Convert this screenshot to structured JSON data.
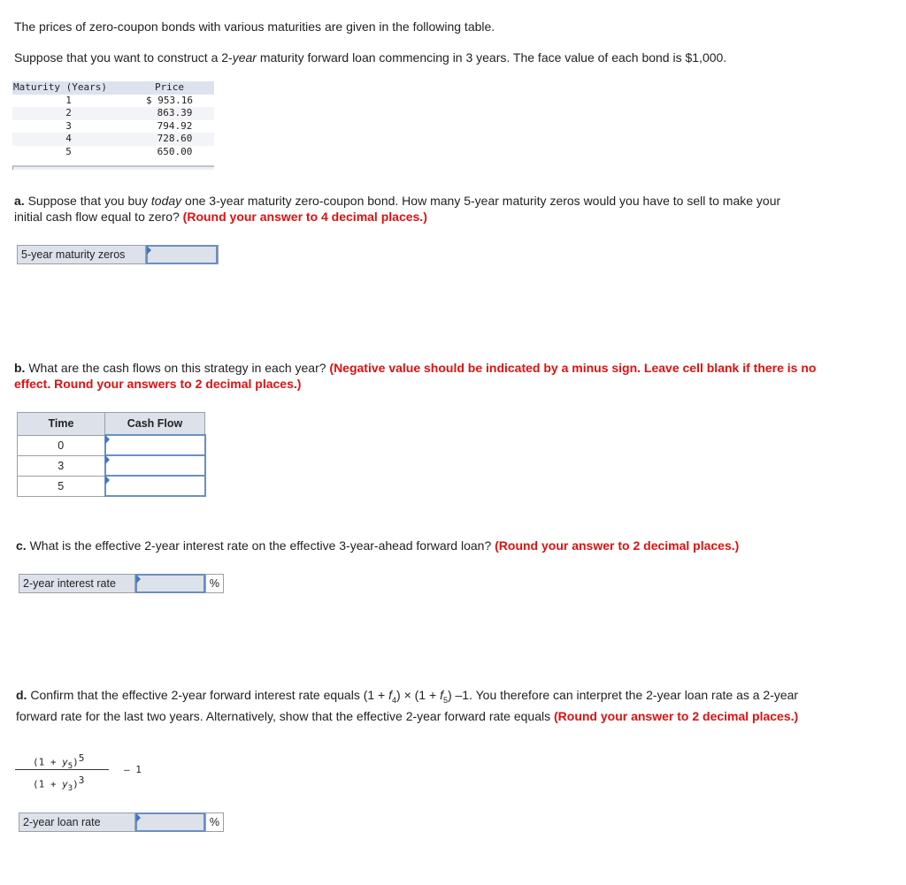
{
  "intro": {
    "line1": "The prices of zero-coupon bonds with various maturities are given in the following table.",
    "line2_pre": "Suppose that you want to construct a 2-",
    "line2_italic": "year",
    "line2_post": " maturity forward loan commencing in 3 years. The face value of each bond is $1,000."
  },
  "bond_table": {
    "headers": [
      "Maturity (Years)",
      "Price"
    ],
    "rows": [
      {
        "maturity": "1",
        "price": "$ 953.16"
      },
      {
        "maturity": "2",
        "price": "863.39"
      },
      {
        "maturity": "3",
        "price": "794.92"
      },
      {
        "maturity": "4",
        "price": "728.60"
      },
      {
        "maturity": "5",
        "price": "650.00"
      }
    ]
  },
  "part_a": {
    "letter": "a.",
    "text_pre": " Suppose that you buy ",
    "text_italic": "today",
    "text_post": " one 3-year maturity zero-coupon bond. How many 5-year maturity zeros would you have to sell to make your initial cash flow equal to zero? ",
    "instruction": "(Round your answer to 4 decimal places.)",
    "answer_label": "5-year maturity zeros",
    "answer_value": ""
  },
  "part_b": {
    "letter": "b.",
    "text": " What are the cash flows on this strategy in each year? ",
    "instruction": "(Negative value should be indicated by a minus sign. Leave cell blank if there is no effect. Round your answers to 2 decimal places.)",
    "table": {
      "headers": [
        "Time",
        "Cash Flow"
      ],
      "rows": [
        {
          "time": "0",
          "cash_flow": ""
        },
        {
          "time": "3",
          "cash_flow": ""
        },
        {
          "time": "5",
          "cash_flow": ""
        }
      ]
    }
  },
  "part_c": {
    "letter": "c.",
    "text": " What is the effective 2-year interest rate on the effective 3-year-ahead forward loan? ",
    "instruction": "(Round your answer to 2 decimal places.)",
    "answer_label": "2-year interest rate",
    "answer_value": "",
    "unit": "%"
  },
  "part_d": {
    "letter": "d.",
    "text_1": " Confirm that the effective 2-year forward interest rate equals (1 + ",
    "f4": "f",
    "f4_sub": "4",
    "text_2": ") × (1 + ",
    "f5": "f",
    "f5_sub": "5",
    "text_3": ") –1. You therefore can interpret the 2-year loan rate as a 2-year forward rate for the last two years. Alternatively, show that the effective 2-year forward rate equals ",
    "instruction": "(Round your answer to 2 decimal places.)",
    "formula": {
      "num_pre": "(1 + ",
      "num_var": "y",
      "num_sub": "5",
      "num_close": ")",
      "num_exp": "5",
      "den_pre": "(1 + ",
      "den_var": "y",
      "den_sub": "3",
      "den_close": ")",
      "den_exp": "3",
      "minus_one": "– 1"
    },
    "answer_label": "2-year loan rate",
    "answer_value": "",
    "unit": "%"
  }
}
